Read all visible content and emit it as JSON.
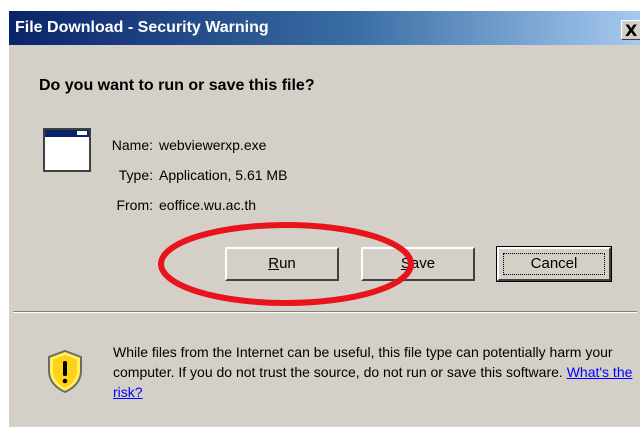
{
  "window": {
    "title": "File Download - Security Warning",
    "close_glyph": "X"
  },
  "main": {
    "question": "Do you want to run or save this file?",
    "file_icon": "application-window-icon",
    "fields": {
      "name_label": "Name:",
      "name_value": "webviewerxp.exe",
      "type_label": "Type:",
      "type_value": "Application, 5.61 MB",
      "from_label": "From:",
      "from_value": "eoffice.wu.ac.th"
    }
  },
  "buttons": {
    "run_prefix": "R",
    "run_rest": "un",
    "save_prefix": "S",
    "save_rest": "ave",
    "cancel_label": "Cancel"
  },
  "warning": {
    "icon": "shield-warning-icon",
    "text": "While files from the Internet can be useful, this file type can potentially harm your computer. If you do not trust the source, do not run or save this software.",
    "link": "What's the risk?"
  },
  "annotation": {
    "color": "#e8141b"
  },
  "colors": {
    "dialog_bg": "#d4d0c8",
    "title_start": "#0a246a",
    "title_end": "#a6caf0",
    "link": "#0000ff"
  }
}
